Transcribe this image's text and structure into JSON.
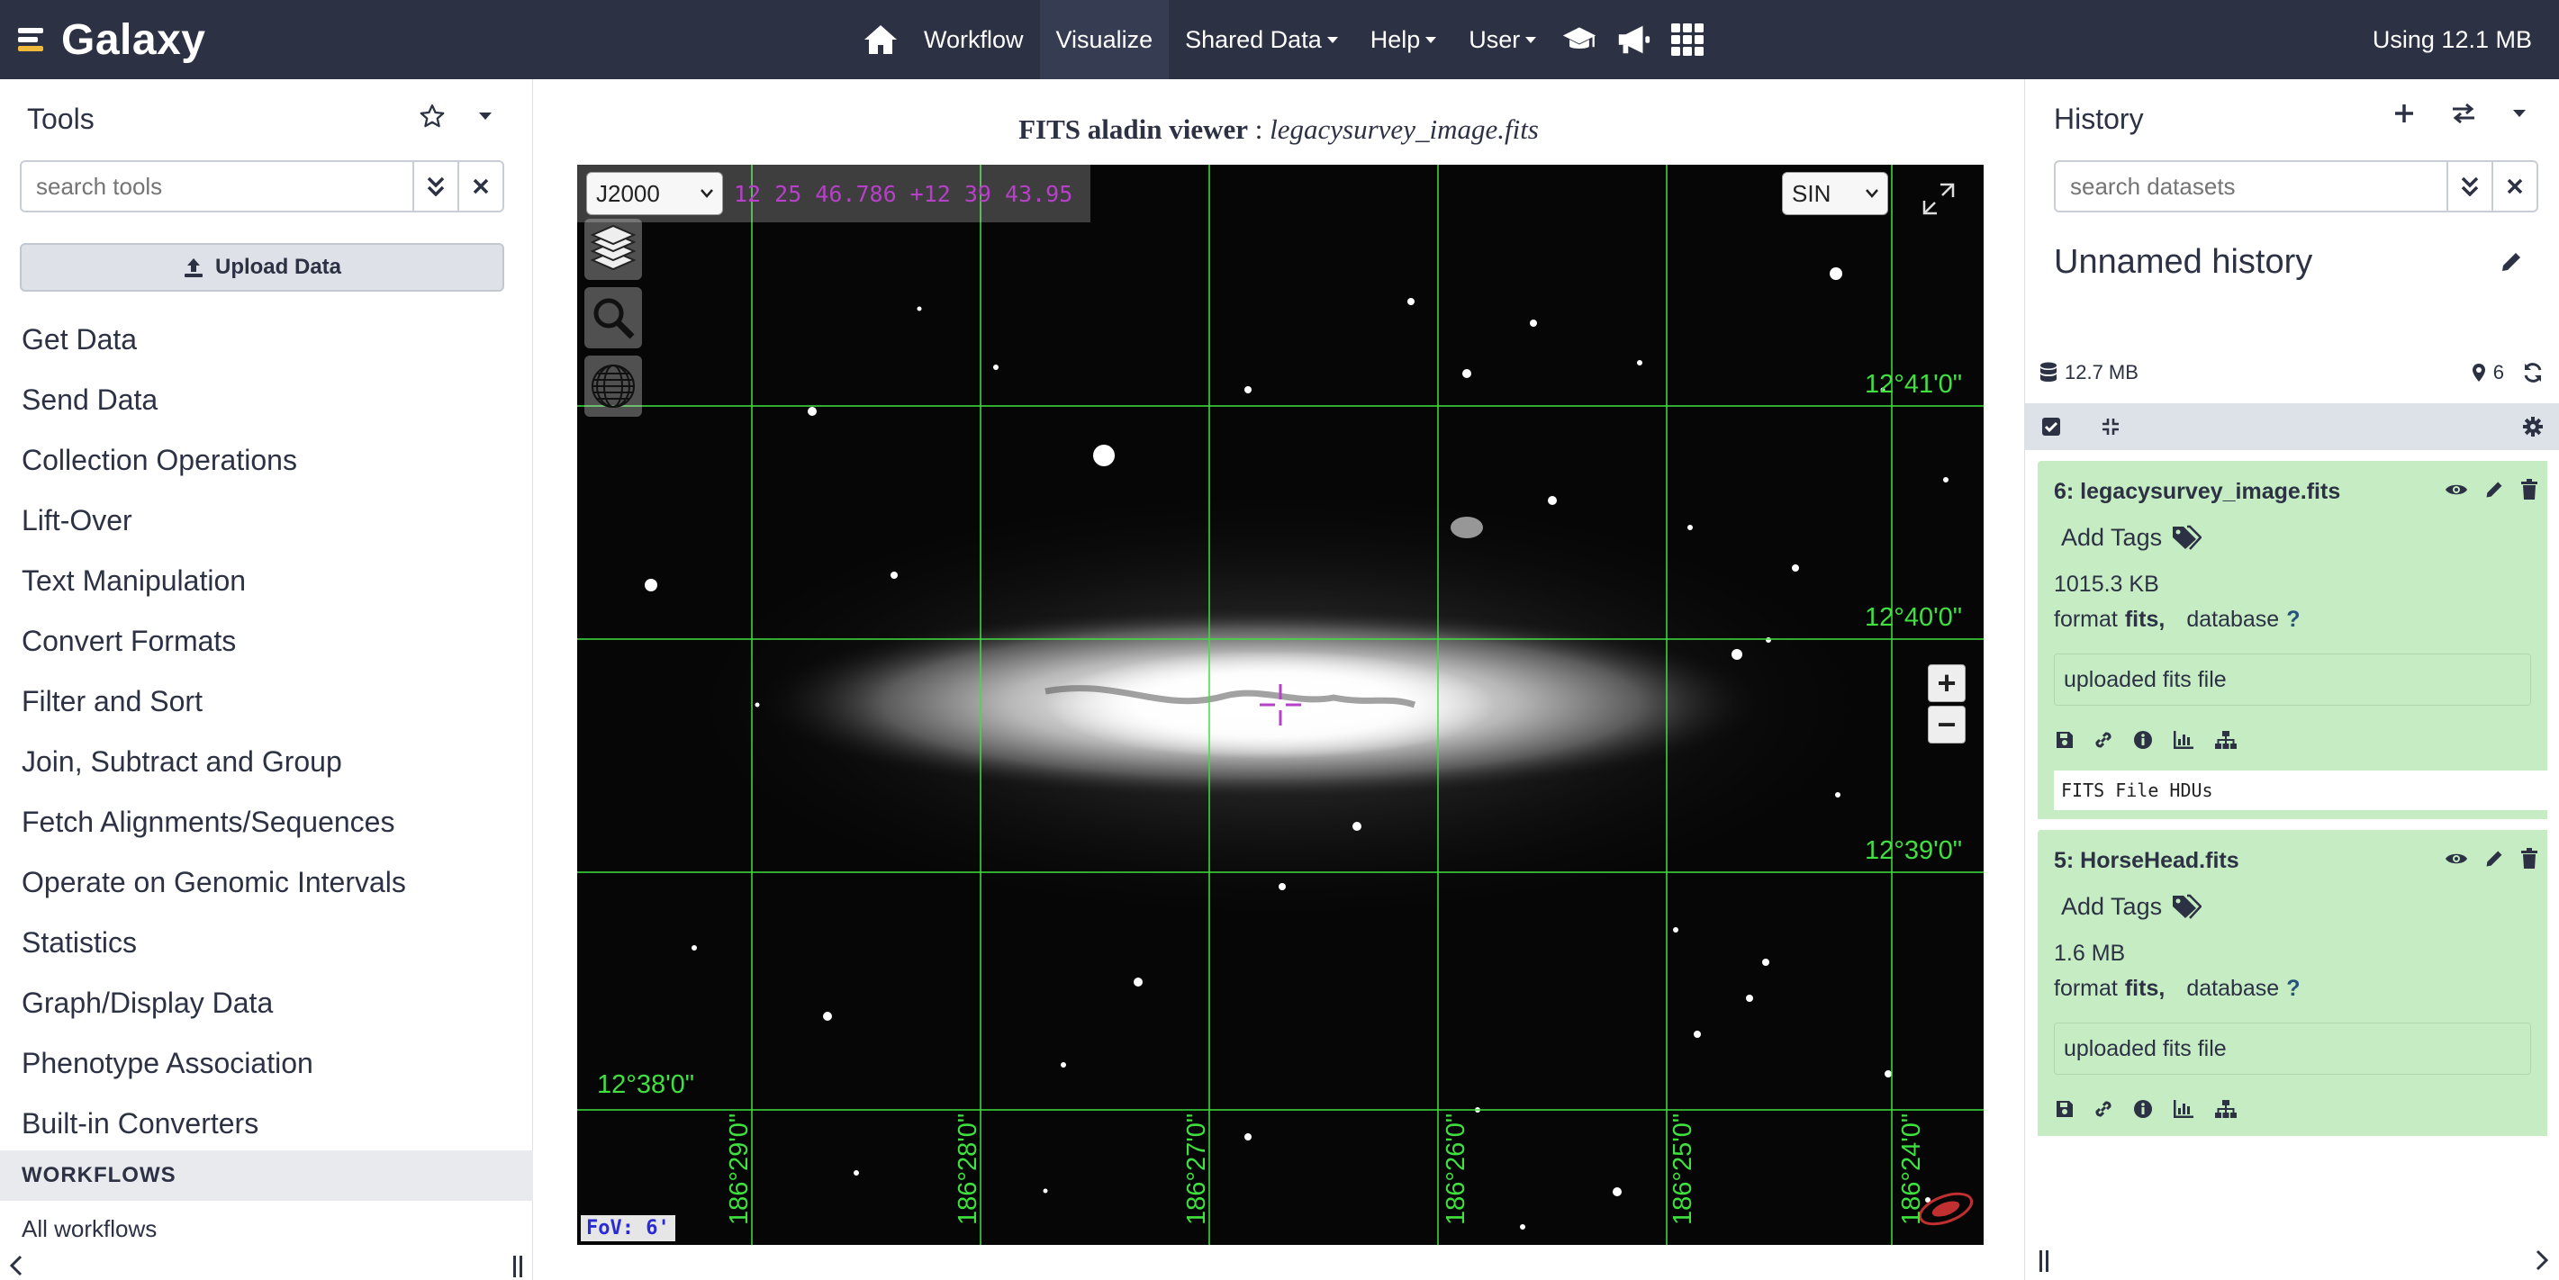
{
  "masthead": {
    "brand": "Galaxy",
    "nav": {
      "workflow": "Workflow",
      "visualize": "Visualize",
      "shared_data": "Shared Data",
      "help": "Help",
      "user": "User"
    },
    "quota": "Using 12.1 MB"
  },
  "tool_panel": {
    "title": "Tools",
    "search_placeholder": "search tools",
    "upload_label": "Upload Data",
    "sections": [
      "Get Data",
      "Send Data",
      "Collection Operations",
      "Lift-Over",
      "Text Manipulation",
      "Convert Formats",
      "Filter and Sort",
      "Join, Subtract and Group",
      "Fetch Alignments/Sequences",
      "Operate on Genomic Intervals",
      "Statistics",
      "Graph/Display Data",
      "Phenotype Association",
      "Built-in Converters"
    ],
    "workflows_header": "WORKFLOWS",
    "all_workflows": "All workflows"
  },
  "viewer": {
    "title_bold": "FITS aladin viewer",
    "title_sep": " : ",
    "title_file": "legacysurvey_image.fits",
    "frame": "J2000",
    "coords": "12 25 46.786 +12 39 43.95",
    "projection": "SIN",
    "dec_labels": [
      "12°41'0\"",
      "12°40'0\"",
      "12°39'0\"",
      "12°38'0\""
    ],
    "ra_labels": [
      "186°29'0\"",
      "186°28'0\"",
      "186°27'0\"",
      "186°26'0\"",
      "186°25'0\"",
      "186°24'0\""
    ],
    "fov": "FoV: 6'",
    "grid_color": "#3fe03f",
    "reticle_color": "#b640c8"
  },
  "history": {
    "title": "History",
    "search_placeholder": "search datasets",
    "name": "Unnamed history",
    "size": "12.7 MB",
    "count": "6",
    "datasets": [
      {
        "title": "6: legacysurvey_image.fits",
        "tags_label": "Add Tags",
        "size": "1015.3 KB",
        "format_label": "format",
        "format": "fits,",
        "database_label": "database",
        "database": "?",
        "info": "uploaded fits file",
        "peek": "FITS File HDUs"
      },
      {
        "title": "5: HorseHead.fits",
        "tags_label": "Add Tags",
        "size": "1.6 MB",
        "format_label": "format",
        "format": "fits,",
        "database_label": "database",
        "database": "?",
        "info": "uploaded fits file"
      }
    ],
    "ok_color": "#c6ecc4"
  },
  "colors": {
    "masthead_bg": "#2c3143",
    "text": "#2c3143"
  }
}
